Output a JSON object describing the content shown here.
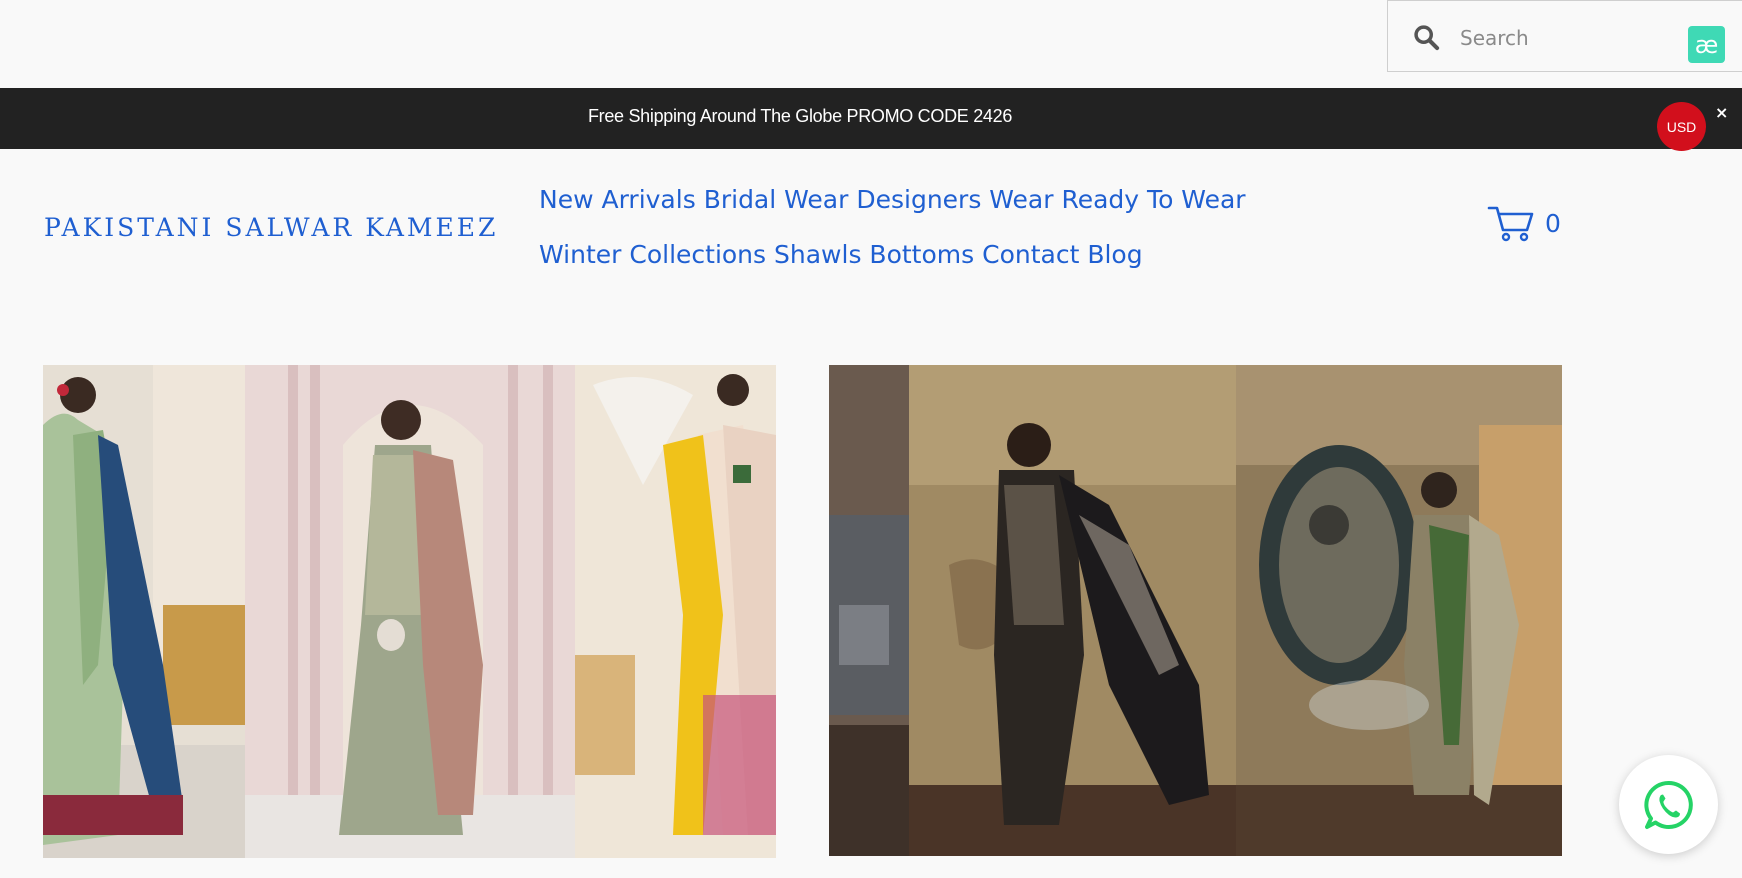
{
  "search": {
    "placeholder": "Search"
  },
  "ae_badge": {
    "label": "æ",
    "color": "#3fd9b5"
  },
  "promo": {
    "text": "Free Shipping Around The Globe PROMO CODE 2426",
    "close": "×"
  },
  "currency": {
    "label": "USD",
    "color": "#d20f1c"
  },
  "brand": {
    "logo": "PAKISTANI SALWAR KAMEEZ"
  },
  "nav": {
    "row1": [
      "New Arrivals",
      "Bridal Wear",
      "Designers Wear",
      "Ready To Wear"
    ],
    "row2": [
      "Winter Collections",
      "Shawls",
      "Bottoms",
      "Contact",
      "Blog"
    ]
  },
  "cart": {
    "count": "0",
    "icon": "cart-icon"
  },
  "colors": {
    "accent": "#1f5fd1",
    "promo_bg": "#222222",
    "whatsapp": "#25d366"
  },
  "whatsapp": {
    "icon": "whatsapp-icon"
  }
}
